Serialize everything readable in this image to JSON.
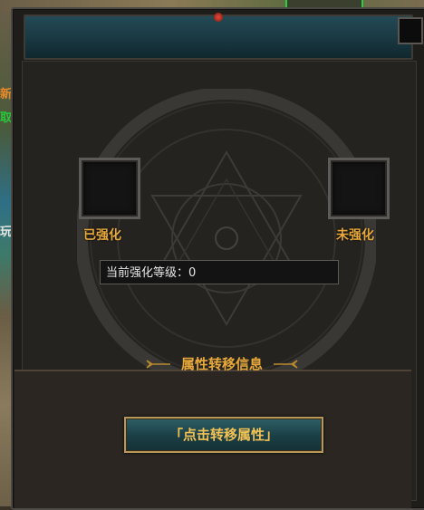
{
  "background": {
    "side_text": [
      "新",
      "取",
      "玩"
    ],
    "side_text_colors": [
      "#e88a2a",
      "#27c83a",
      "#e6e6e6"
    ]
  },
  "panel": {
    "strengthened_label": "已强化",
    "unstrengthened_label": "未强化",
    "level_label": "当前强化等级：",
    "level_value": "0",
    "info_title": "属性转移信息",
    "transfer_button": "「点击转移属性」"
  },
  "colors": {
    "accent": "#e8a93a",
    "header_teal": "#244a55",
    "button_gold": "#f2c255"
  }
}
